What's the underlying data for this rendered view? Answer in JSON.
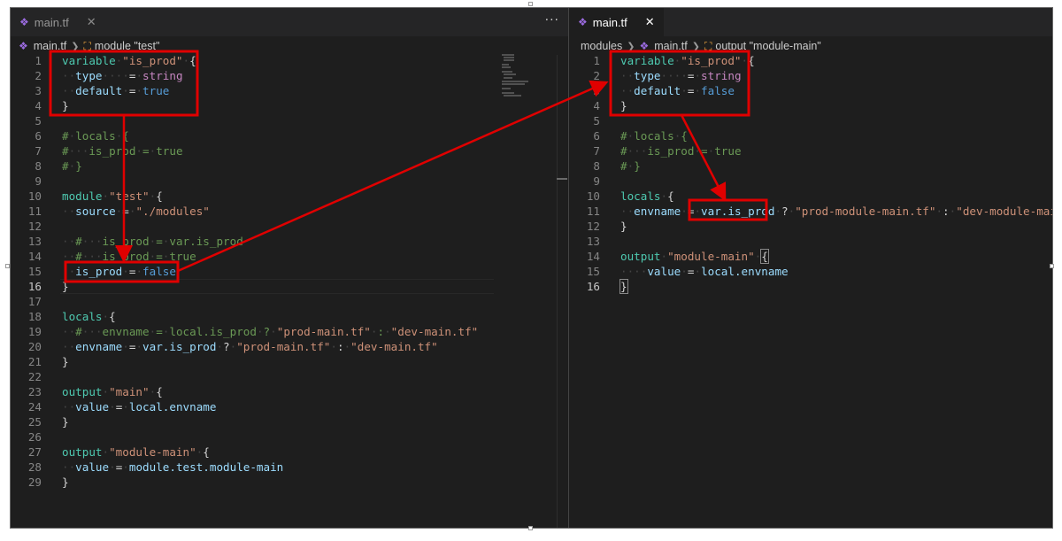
{
  "left": {
    "tab": {
      "icon": "terraform-icon",
      "label": "main.tf",
      "close": "✕"
    },
    "more": "···",
    "breadcrumb": {
      "file": "main.tf",
      "symbol": "module \"test\""
    },
    "lines": [
      {
        "n": "1"
      },
      {
        "n": "2"
      },
      {
        "n": "3"
      },
      {
        "n": "4"
      },
      {
        "n": "5"
      },
      {
        "n": "6"
      },
      {
        "n": "7"
      },
      {
        "n": "8"
      },
      {
        "n": "9"
      },
      {
        "n": "10"
      },
      {
        "n": "11"
      },
      {
        "n": "12"
      },
      {
        "n": "13"
      },
      {
        "n": "14"
      },
      {
        "n": "15"
      },
      {
        "n": "16"
      },
      {
        "n": "17"
      },
      {
        "n": "18"
      },
      {
        "n": "19"
      },
      {
        "n": "20"
      },
      {
        "n": "21"
      },
      {
        "n": "22"
      },
      {
        "n": "23"
      },
      {
        "n": "24"
      },
      {
        "n": "25"
      },
      {
        "n": "26"
      },
      {
        "n": "27"
      },
      {
        "n": "28"
      },
      {
        "n": "29"
      }
    ],
    "code": {
      "l1": {
        "kw": "variable",
        "str": "\"is_prod\"",
        "br": "{"
      },
      "l2": {
        "attr": "type",
        "op": "=",
        "val": "string"
      },
      "l3": {
        "attr": "default",
        "op": "=",
        "val": "true"
      },
      "l4": {
        "br": "}"
      },
      "l6": {
        "c1": "#",
        "c2": "locals",
        "c3": "{"
      },
      "l7": {
        "c1": "#",
        "c2": "is_prod",
        "c3": "=",
        "c4": "true"
      },
      "l8": {
        "c1": "#",
        "c2": "}"
      },
      "l10": {
        "kw": "module",
        "str": "\"test\"",
        "br": "{"
      },
      "l11": {
        "attr": "source",
        "op": "=",
        "val": "\"./modules\""
      },
      "l13": {
        "c1": "#",
        "c2": "is_prod",
        "c3": "=",
        "c4": "var.is_prod"
      },
      "l14": {
        "c1": "#",
        "c2": "is_prod",
        "c3": "=",
        "c4": "true"
      },
      "l15": {
        "attr": "is_prod",
        "op": "=",
        "val": "false"
      },
      "l16": {
        "br": "}"
      },
      "l18": {
        "kw": "locals",
        "br": "{"
      },
      "l19": {
        "c1": "#",
        "c2": "envname",
        "c3": "=",
        "c4": "local.is_prod",
        "c5": "?",
        "c6": "\"prod-main.tf\"",
        "c7": ":",
        "c8": "\"dev-main.tf\""
      },
      "l20": {
        "attr": "envname",
        "op": "=",
        "ref": "var.is_prod",
        "q": "?",
        "s1": "\"prod-main.tf\"",
        "colon": ":",
        "s2": "\"dev-main.tf\""
      },
      "l21": {
        "br": "}"
      },
      "l23": {
        "kw": "output",
        "str": "\"main\"",
        "br": "{"
      },
      "l24": {
        "attr": "value",
        "op": "=",
        "ref": "local.envname"
      },
      "l25": {
        "br": "}"
      },
      "l27": {
        "kw": "output",
        "str": "\"module-main\"",
        "br": "{"
      },
      "l28": {
        "attr": "value",
        "op": "=",
        "ref": "module.test.module-main"
      },
      "l29": {
        "br": "}"
      }
    }
  },
  "right": {
    "tab": {
      "icon": "terraform-icon",
      "label": "main.tf",
      "close": "✕"
    },
    "breadcrumb": {
      "folder": "modules",
      "file": "main.tf",
      "symbol": "output \"module-main\""
    },
    "lines": [
      {
        "n": "1"
      },
      {
        "n": "2"
      },
      {
        "n": "3"
      },
      {
        "n": "4"
      },
      {
        "n": "5"
      },
      {
        "n": "6"
      },
      {
        "n": "7"
      },
      {
        "n": "8"
      },
      {
        "n": "9"
      },
      {
        "n": "10"
      },
      {
        "n": "11"
      },
      {
        "n": "12"
      },
      {
        "n": "13"
      },
      {
        "n": "14"
      },
      {
        "n": "15"
      },
      {
        "n": "16"
      }
    ],
    "code": {
      "l1": {
        "kw": "variable",
        "str": "\"is_prod\"",
        "br": "{"
      },
      "l2": {
        "attr": "type",
        "op": "=",
        "val": "string"
      },
      "l3": {
        "attr": "default",
        "op": "=",
        "val": "false"
      },
      "l4": {
        "br": "}"
      },
      "l6": {
        "c1": "#",
        "c2": "locals",
        "c3": "{"
      },
      "l7": {
        "c1": "#",
        "c2": "is_prod",
        "c3": "=",
        "c4": "true"
      },
      "l8": {
        "c1": "#",
        "c2": "}"
      },
      "l10": {
        "kw": "locals",
        "br": "{"
      },
      "l11": {
        "attr": "envname",
        "op": "=",
        "ref": "var.is_prod",
        "q": "?",
        "s1": "\"prod-module-main.tf\"",
        "colon": ":",
        "s2": "\"dev-module-main.tf\""
      },
      "l12": {
        "br": "}"
      },
      "l14": {
        "kw": "output",
        "str": "\"module-main\"",
        "br": "{"
      },
      "l15": {
        "attr": "value",
        "op": "=",
        "ref": "local.envname"
      },
      "l16": {
        "br": "}"
      }
    }
  },
  "colors": {
    "annotation": "#e00000",
    "editor_bg": "#1e1e1e",
    "keyword": "#4ec9b0",
    "string": "#ce9178",
    "comment": "#6a9955"
  }
}
